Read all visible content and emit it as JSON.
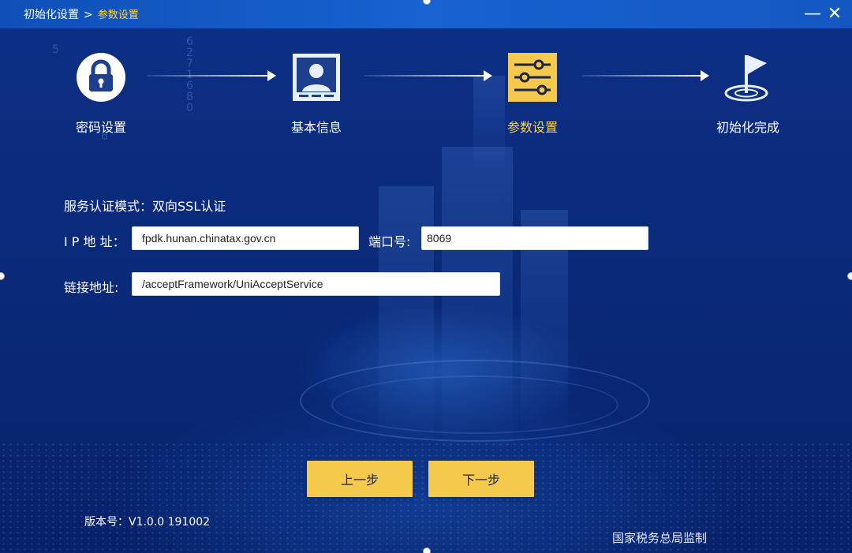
{
  "breadcrumb": {
    "root": "初始化设置",
    "separator": ">",
    "current": "参数设置"
  },
  "window_controls": {
    "minimize": "—",
    "close": "✕"
  },
  "steps": [
    {
      "label": "密码设置",
      "icon": "lock-icon",
      "state": "done"
    },
    {
      "label": "基本信息",
      "icon": "id-card-icon",
      "state": "done"
    },
    {
      "label": "参数设置",
      "icon": "sliders-icon",
      "state": "active"
    },
    {
      "label": "初始化完成",
      "icon": "flag-icon",
      "state": "pending"
    }
  ],
  "form": {
    "mode_line": "服务认证模式：双向SSL认证",
    "ip_label": "I P 地 址：",
    "ip_value": "fpdk.hunan.chinatax.gov.cn",
    "port_label": "端口号:",
    "port_value": "8069",
    "link_label": "链接地址:",
    "link_value": "/acceptFramework/UniAcceptService"
  },
  "buttons": {
    "prev": "上一步",
    "next": "下一步"
  },
  "version": "版本号：V1.0.0 191002",
  "footer": "国家税务总局监制",
  "colors": {
    "background": "#0a2a7a",
    "titlebar": "#1763d0",
    "accent": "#ffd04a",
    "button": "#f4c94c"
  }
}
